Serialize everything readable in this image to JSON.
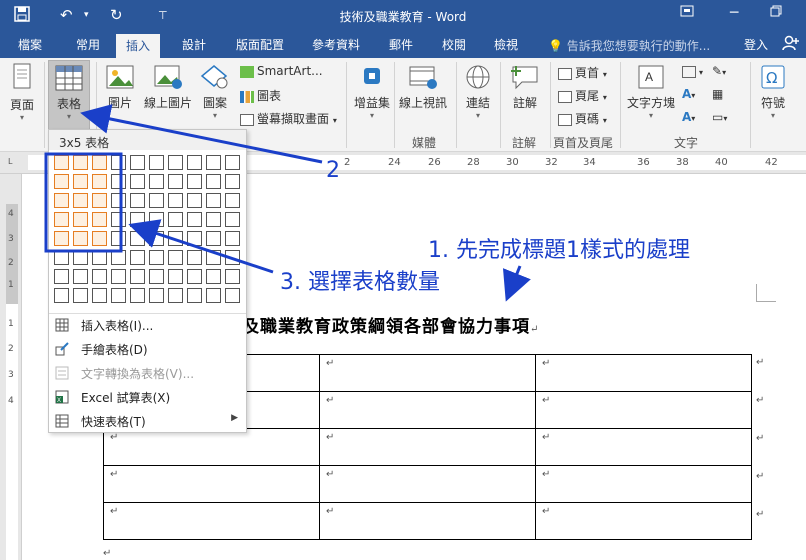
{
  "window": {
    "title": "技術及職業教育 - Word"
  },
  "tabs": [
    {
      "label": "檔案"
    },
    {
      "label": "常用"
    },
    {
      "label": "插入"
    },
    {
      "label": "設計"
    },
    {
      "label": "版面配置"
    },
    {
      "label": "參考資料"
    },
    {
      "label": "郵件"
    },
    {
      "label": "校閱"
    },
    {
      "label": "檢視"
    }
  ],
  "tell_me": "告訴我您想要執行的動作...",
  "sign_in": "登入",
  "ribbon": {
    "page": "頁面",
    "table": "表格",
    "pictures": "圖片",
    "online_pictures": "線上圖片",
    "shapes": "圖案",
    "smartart": "SmartArt...",
    "chart": "圖表",
    "screenshot": "螢幕擷取畫面",
    "addins": "增益集",
    "online_video": "線上視訊",
    "link": "連結",
    "comment": "註解",
    "header": "頁首",
    "footer": "頁尾",
    "page_number": "頁碼",
    "textbox": "文字方塊",
    "symbol": "符號",
    "groups": {
      "media": "媒體",
      "comments": "註解",
      "header_footer": "頁首及頁尾",
      "text": "文字"
    }
  },
  "ruler_numbers": [
    "2",
    "24",
    "26",
    "28",
    "30",
    "32",
    "34",
    "36",
    "38",
    "40",
    "42"
  ],
  "vruler_numbers": [
    "4",
    "3",
    "2",
    "1",
    "1",
    "2",
    "3",
    "4"
  ],
  "table_dropdown": {
    "header": "3x5 表格",
    "grid_cols": 10,
    "grid_rows": 8,
    "selected_cols": 3,
    "selected_rows": 5,
    "items": [
      {
        "label": "插入表格(I)...",
        "disabled": false
      },
      {
        "label": "手繪表格(D)",
        "disabled": false
      },
      {
        "label": "文字轉換為表格(V)...",
        "disabled": true
      },
      {
        "label": "Excel 試算表(X)",
        "disabled": false
      },
      {
        "label": "快速表格(T)",
        "disabled": false
      }
    ]
  },
  "document": {
    "heading": "技術及職業教育政策綱領各部會協力事項",
    "heading_visible": "及職業教育政策綱領各部會協力事項",
    "para_mark": "↵",
    "table_rows": 5,
    "table_cols": 3
  },
  "annotations": {
    "step1": "1. 先完成標題1樣式的處理",
    "step2": "2",
    "step3": "3. 選擇表格數量"
  },
  "colors": {
    "brand": "#2b579a",
    "annotation": "#1a3fc9",
    "grid_highlight": "#e67e22"
  }
}
